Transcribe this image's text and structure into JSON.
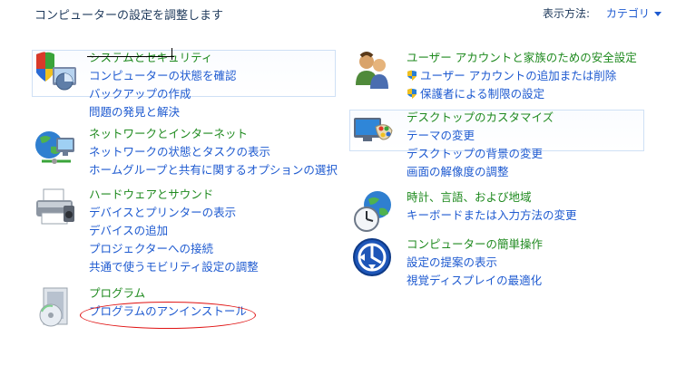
{
  "header": {
    "title": "コンピューターの設定を調整します",
    "view_by_label": "表示方法:",
    "view_by_value": "カテゴリ"
  },
  "categories": {
    "system": {
      "title": "システムとセキュリティ",
      "links": [
        "コンピューターの状態を確認",
        "バックアップの作成",
        "問題の発見と解決"
      ],
      "icon": "shield-monitor-icon"
    },
    "network": {
      "title": "ネットワークとインターネット",
      "links": [
        "ネットワークの状態とタスクの表示",
        "ホームグループと共有に関するオプションの選択"
      ],
      "icon": "network-globe-icon"
    },
    "hardware": {
      "title": "ハードウェアとサウンド",
      "links": [
        "デバイスとプリンターの表示",
        "デバイスの追加",
        "プロジェクターへの接続",
        "共通で使うモビリティ設定の調整"
      ],
      "icon": "printer-icon"
    },
    "programs": {
      "title": "プログラム",
      "links": [
        "プログラムのアンインストール"
      ],
      "icon": "programs-disc-icon"
    },
    "users": {
      "title": "ユーザー アカウントと家族のための安全設定",
      "links": [
        "ユーザー アカウントの追加または削除",
        "保護者による制限の設定"
      ],
      "icon": "users-icon"
    },
    "appearance": {
      "title": "デスクトップのカスタマイズ",
      "links": [
        "テーマの変更",
        "デスクトップの背景の変更",
        "画面の解像度の調整"
      ],
      "icon": "desktop-palette-icon"
    },
    "clock": {
      "title": "時計、言語、および地域",
      "links": [
        "キーボードまたは入力方法の変更"
      ],
      "icon": "clock-globe-icon"
    },
    "ease": {
      "title": "コンピューターの簡単操作",
      "links": [
        "設定の提案の表示",
        "視覚ディスプレイの最適化"
      ],
      "icon": "ease-of-access-icon"
    }
  },
  "colors": {
    "link": "#1e5ad0",
    "title": "#1f8a1f",
    "annotation": "#e01212"
  }
}
